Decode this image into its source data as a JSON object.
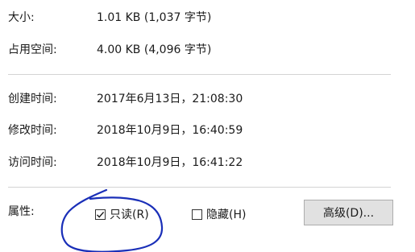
{
  "properties": {
    "size": {
      "label": "大小:",
      "value": "1.01 KB (1,037 字节)"
    },
    "size_on_disk": {
      "label": "占用空间:",
      "value": "4.00 KB (4,096 字节)"
    },
    "created": {
      "label": "创建时间:",
      "value": "2017年6月13日，21:08:30"
    },
    "modified": {
      "label": "修改时间:",
      "value": "2018年10月9日，16:40:59"
    },
    "accessed": {
      "label": "访问时间:",
      "value": "2018年10月9日，16:41:22"
    }
  },
  "attributes": {
    "label": "属性:",
    "readonly": {
      "label": "只读(R)",
      "checked": true
    },
    "hidden": {
      "label": "隐藏(H)",
      "checked": false
    },
    "advanced_button": "高级(D)..."
  },
  "annotation": {
    "color": "#1a2fb8",
    "shape": "hand-drawn circle around read-only checkbox"
  }
}
